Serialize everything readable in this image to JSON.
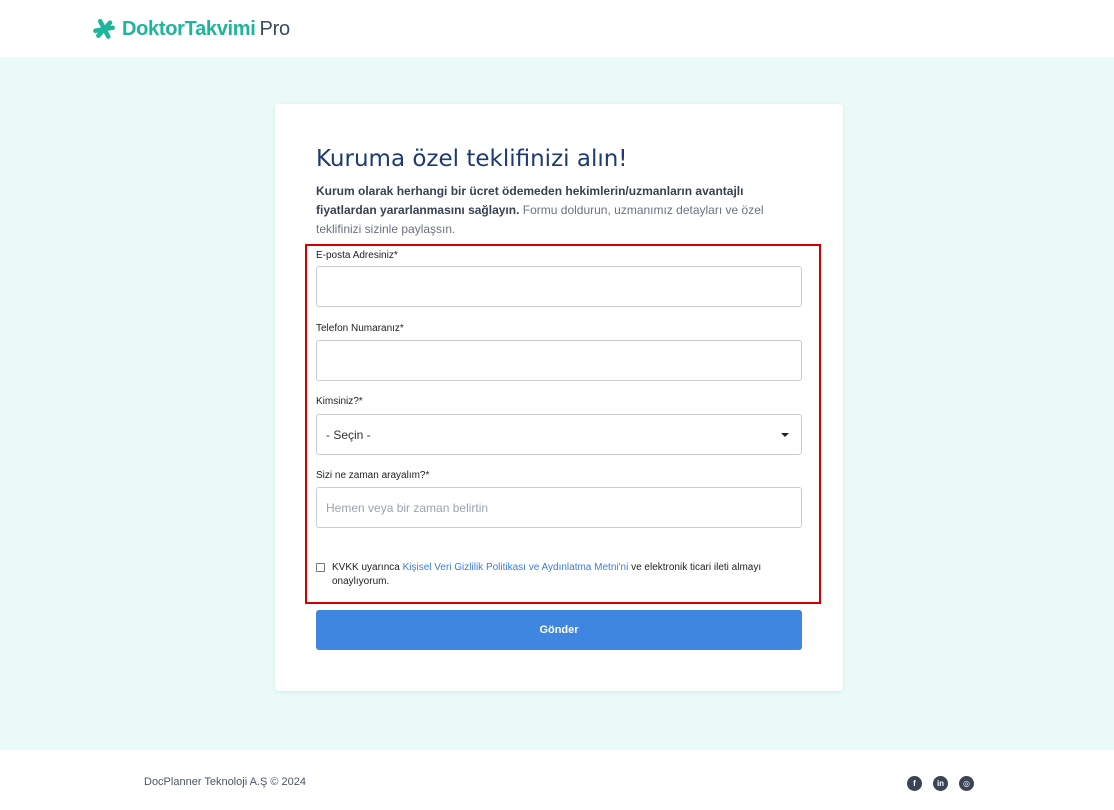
{
  "header": {
    "logo_main": "DoktorTakvimi",
    "logo_pro": "Pro"
  },
  "form": {
    "title": "Kuruma özel teklifinizi alın!",
    "intro_bold": "Kurum olarak herhangi bir ücret ödemeden hekimlerin/uzmanların avantajlı fiyatlardan yararlanmasını sağlayın.",
    "intro_rest": " Formu doldurun, uzmanımız detayları ve özel teklifinizi sizinle paylaşsın.",
    "email_label": "E-posta Adresiniz*",
    "email_value": "",
    "phone_label": "Telefon Numaranız*",
    "phone_value": "",
    "who_label": "Kimsiniz?*",
    "who_selected": "- Seçin -",
    "when_label": "Sizi ne zaman arayalım?*",
    "when_placeholder": "Hemen veya bir zaman belirtin",
    "consent_prefix": "KVKK uyarınca ",
    "consent_link": "Kişisel Veri Gizlilik Politikası ve Aydınlatma Metni'ni",
    "consent_suffix": " ve elektronik ticari ileti almayı onaylıyorum.",
    "consent_checked": false,
    "submit_label": "Gönder"
  },
  "footer": {
    "copyright": "DocPlanner Teknoloji A.Ş © 2024",
    "social": [
      {
        "icon": "facebook-icon",
        "glyph": "f"
      },
      {
        "icon": "linkedin-icon",
        "glyph": "in"
      },
      {
        "icon": "instagram-icon",
        "glyph": "◎"
      }
    ]
  },
  "colors": {
    "brand": "#1fb59a",
    "title": "#1e3a6e",
    "button": "#3e86e0",
    "highlight": "#d40000",
    "background": "#eafaf8"
  }
}
